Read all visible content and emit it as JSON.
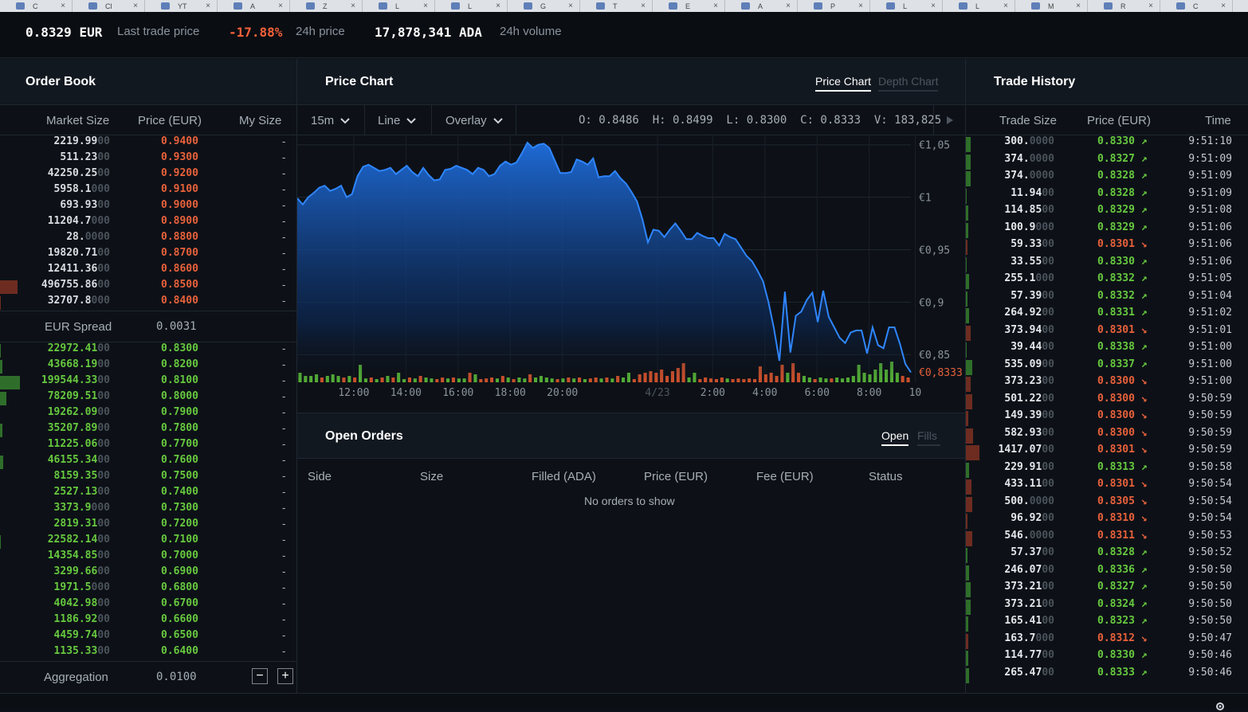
{
  "browser_tabs": [
    "C",
    "Cl",
    "YT",
    "A",
    "Z",
    "L",
    "L",
    "G",
    "T",
    "E",
    "A",
    "P",
    "L",
    "L",
    "M",
    "R",
    "C"
  ],
  "ticker": {
    "last_price": "0.8329",
    "last_ccy": "EUR",
    "last_label": "Last trade price",
    "change": "-17.88%",
    "change_label": "24h price",
    "volume": "17,878,341",
    "volume_ccy": "ADA",
    "volume_label": "24h volume"
  },
  "colors": {
    "ask": "#e8613b",
    "bid": "#67c93f",
    "line": "#2f86ff",
    "bg": "#0d1117"
  },
  "order_book": {
    "title": "Order Book",
    "headers": {
      "market_size": "Market Size",
      "price": "Price (EUR)",
      "my_size": "My Size"
    },
    "asks": [
      {
        "size": "2219.99",
        "pad": "00",
        "price": "0.9400",
        "my": "-",
        "depth": 0
      },
      {
        "size": "511.23",
        "pad": "00",
        "price": "0.9300",
        "my": "-",
        "depth": 0
      },
      {
        "size": "42250.25",
        "pad": "00",
        "price": "0.9200",
        "my": "-",
        "depth": 0
      },
      {
        "size": "5958.1",
        "pad": "000",
        "price": "0.9100",
        "my": "-",
        "depth": 0
      },
      {
        "size": "693.93",
        "pad": "00",
        "price": "0.9000",
        "my": "-",
        "depth": 0
      },
      {
        "size": "11204.7",
        "pad": "000",
        "price": "0.8900",
        "my": "-",
        "depth": 0
      },
      {
        "size": "28.",
        "pad": "0000",
        "price": "0.8800",
        "my": "-",
        "depth": 0
      },
      {
        "size": "19820.71",
        "pad": "00",
        "price": "0.8700",
        "my": "-",
        "depth": 0
      },
      {
        "size": "12411.36",
        "pad": "00",
        "price": "0.8600",
        "my": "-",
        "depth": 0
      },
      {
        "size": "496755.86",
        "pad": "00",
        "price": "0.8500",
        "my": "-",
        "depth": 22
      },
      {
        "size": "32707.8",
        "pad": "000",
        "price": "0.8400",
        "my": "-",
        "depth": 1
      }
    ],
    "spread_label": "EUR Spread",
    "spread_value": "0.0031",
    "bids": [
      {
        "size": "22972.41",
        "pad": "00",
        "price": "0.8300",
        "my": "-",
        "depth": 1
      },
      {
        "size": "43668.19",
        "pad": "00",
        "price": "0.8200",
        "my": "-",
        "depth": 3
      },
      {
        "size": "199544.33",
        "pad": "00",
        "price": "0.8100",
        "my": "-",
        "depth": 25
      },
      {
        "size": "78209.51",
        "pad": "00",
        "price": "0.8000",
        "my": "-",
        "depth": 8
      },
      {
        "size": "19262.09",
        "pad": "00",
        "price": "0.7900",
        "my": "-",
        "depth": 0
      },
      {
        "size": "35207.89",
        "pad": "00",
        "price": "0.7800",
        "my": "-",
        "depth": 3
      },
      {
        "size": "11225.06",
        "pad": "00",
        "price": "0.7700",
        "my": "-",
        "depth": 0
      },
      {
        "size": "46155.34",
        "pad": "00",
        "price": "0.7600",
        "my": "-",
        "depth": 4
      },
      {
        "size": "8159.35",
        "pad": "00",
        "price": "0.7500",
        "my": "-",
        "depth": 0
      },
      {
        "size": "2527.13",
        "pad": "00",
        "price": "0.7400",
        "my": "-",
        "depth": 0
      },
      {
        "size": "3373.9",
        "pad": "000",
        "price": "0.7300",
        "my": "-",
        "depth": 0
      },
      {
        "size": "2819.31",
        "pad": "00",
        "price": "0.7200",
        "my": "-",
        "depth": 0
      },
      {
        "size": "22582.14",
        "pad": "00",
        "price": "0.7100",
        "my": "-",
        "depth": 1
      },
      {
        "size": "14354.85",
        "pad": "00",
        "price": "0.7000",
        "my": "-",
        "depth": 0
      },
      {
        "size": "3299.66",
        "pad": "00",
        "price": "0.6900",
        "my": "-",
        "depth": 0
      },
      {
        "size": "1971.5",
        "pad": "000",
        "price": "0.6800",
        "my": "-",
        "depth": 0
      },
      {
        "size": "4042.98",
        "pad": "00",
        "price": "0.6700",
        "my": "-",
        "depth": 0
      },
      {
        "size": "1186.92",
        "pad": "00",
        "price": "0.6600",
        "my": "-",
        "depth": 0
      },
      {
        "size": "4459.74",
        "pad": "00",
        "price": "0.6500",
        "my": "-",
        "depth": 0
      },
      {
        "size": "1135.33",
        "pad": "00",
        "price": "0.6400",
        "my": "-",
        "depth": 0
      }
    ],
    "aggregation_label": "Aggregation",
    "aggregation_value": "0.0100",
    "minus": "−",
    "plus": "+"
  },
  "price_chart": {
    "title": "Price Chart",
    "tab_active": "Price Chart",
    "tab_inactive": "Depth Chart",
    "interval": "15m",
    "chart_kind": "Line",
    "overlay": "Overlay",
    "ohlc": "O: 0.8486  H: 0.8499  L: 0.8300  C: 0.8333  V: 183,825",
    "current_price_label": "€0,8333"
  },
  "chart_data": {
    "type": "area",
    "title": "",
    "x_tick_labels": [
      "12:00",
      "14:00",
      "16:00",
      "18:00",
      "20:00",
      "4/23",
      "2:00",
      "4:00",
      "6:00",
      "8:00",
      "10"
    ],
    "y_tick_labels": [
      "€1,05",
      "€1",
      "€0,95",
      "€0,9",
      "€0,85"
    ],
    "ylim": [
      0.8236,
      1.0589
    ],
    "current_price": 0.8333,
    "series": [
      {
        "values": [
          0.999,
          0.993,
          1.0,
          1.004,
          1.009,
          1.011,
          1.006,
          1.008,
          1.011,
          1.0,
          1.003,
          1.02,
          1.029,
          1.031,
          1.028,
          1.025,
          1.026,
          1.028,
          1.022,
          1.026,
          1.03,
          1.024,
          1.02,
          1.028,
          1.021,
          1.016,
          1.017,
          1.026,
          1.027,
          1.03,
          1.028,
          1.026,
          1.022,
          1.028,
          1.026,
          1.02,
          1.022,
          1.03,
          1.034,
          1.031,
          1.033,
          1.042,
          1.052,
          1.047,
          1.05,
          1.051,
          1.047,
          1.035,
          1.023,
          1.023,
          1.024,
          1.036,
          1.034,
          1.031,
          1.037,
          1.019,
          1.02,
          1.02,
          1.025,
          1.018,
          1.013,
          1.005,
          0.996,
          0.979,
          0.957,
          0.969,
          0.968,
          0.962,
          0.969,
          0.975,
          0.968,
          0.96,
          0.96,
          0.966,
          0.963,
          0.961,
          0.961,
          0.954,
          0.965,
          0.962,
          0.96,
          0.952,
          0.944,
          0.939,
          0.93,
          0.92,
          0.9,
          0.875,
          0.844,
          0.91,
          0.852,
          0.887,
          0.891,
          0.902,
          0.909,
          0.881,
          0.911,
          0.886,
          0.876,
          0.866,
          0.861,
          0.871,
          0.873,
          0.873,
          0.851,
          0.876,
          0.859,
          0.856,
          0.876,
          0.876,
          0.86,
          0.841,
          0.833
        ]
      }
    ],
    "volume_ticks": [
      {
        "v": 0.3,
        "up": true
      },
      {
        "v": 0.2,
        "up": true
      },
      {
        "v": 0.2,
        "up": true
      },
      {
        "v": 0.25,
        "up": true
      },
      {
        "v": 0.15,
        "up": false
      },
      {
        "v": 0.2,
        "up": true
      },
      {
        "v": 0.25,
        "up": true
      },
      {
        "v": 0.2,
        "up": true
      },
      {
        "v": 0.15,
        "up": false
      },
      {
        "v": 0.2,
        "up": true
      },
      {
        "v": 0.15,
        "up": false
      },
      {
        "v": 0.55,
        "up": true
      },
      {
        "v": 0.12,
        "up": true
      },
      {
        "v": 0.15,
        "up": false
      },
      {
        "v": 0.1,
        "up": true
      },
      {
        "v": 0.15,
        "up": false
      },
      {
        "v": 0.2,
        "up": true
      },
      {
        "v": 0.15,
        "up": false
      },
      {
        "v": 0.3,
        "up": true
      },
      {
        "v": 0.1,
        "up": true
      },
      {
        "v": 0.15,
        "up": false
      },
      {
        "v": 0.12,
        "up": true
      },
      {
        "v": 0.2,
        "up": false
      },
      {
        "v": 0.15,
        "up": true
      },
      {
        "v": 0.12,
        "up": true
      },
      {
        "v": 0.1,
        "up": false
      },
      {
        "v": 0.15,
        "up": false
      },
      {
        "v": 0.12,
        "up": true
      },
      {
        "v": 0.15,
        "up": false
      },
      {
        "v": 0.12,
        "up": true
      },
      {
        "v": 0.12,
        "up": true
      },
      {
        "v": 0.3,
        "up": false
      },
      {
        "v": 0.25,
        "up": true
      },
      {
        "v": 0.1,
        "up": false
      },
      {
        "v": 0.12,
        "up": false
      },
      {
        "v": 0.15,
        "up": false
      },
      {
        "v": 0.12,
        "up": true
      },
      {
        "v": 0.2,
        "up": false
      },
      {
        "v": 0.15,
        "up": true
      },
      {
        "v": 0.1,
        "up": false
      },
      {
        "v": 0.15,
        "up": true
      },
      {
        "v": 0.12,
        "up": true
      },
      {
        "v": 0.25,
        "up": false
      },
      {
        "v": 0.15,
        "up": true
      },
      {
        "v": 0.2,
        "up": true
      },
      {
        "v": 0.15,
        "up": true
      },
      {
        "v": 0.12,
        "up": true
      },
      {
        "v": 0.1,
        "up": false
      },
      {
        "v": 0.12,
        "up": true
      },
      {
        "v": 0.15,
        "up": false
      },
      {
        "v": 0.12,
        "up": true
      },
      {
        "v": 0.15,
        "up": false
      },
      {
        "v": 0.1,
        "up": true
      },
      {
        "v": 0.12,
        "up": false
      },
      {
        "v": 0.15,
        "up": false
      },
      {
        "v": 0.12,
        "up": true
      },
      {
        "v": 0.15,
        "up": false
      },
      {
        "v": 0.12,
        "up": true
      },
      {
        "v": 0.2,
        "up": false
      },
      {
        "v": 0.15,
        "up": true
      },
      {
        "v": 0.3,
        "up": true
      },
      {
        "v": 0.1,
        "up": false
      },
      {
        "v": 0.25,
        "up": false
      },
      {
        "v": 0.3,
        "up": false
      },
      {
        "v": 0.35,
        "up": false
      },
      {
        "v": 0.3,
        "up": false
      },
      {
        "v": 0.4,
        "up": false
      },
      {
        "v": 0.2,
        "up": false
      },
      {
        "v": 0.35,
        "up": false
      },
      {
        "v": 0.45,
        "up": false
      },
      {
        "v": 0.6,
        "up": false
      },
      {
        "v": 0.15,
        "up": true
      },
      {
        "v": 0.3,
        "up": true
      },
      {
        "v": 0.1,
        "up": false
      },
      {
        "v": 0.15,
        "up": false
      },
      {
        "v": 0.12,
        "up": false
      },
      {
        "v": 0.1,
        "up": false
      },
      {
        "v": 0.15,
        "up": false
      },
      {
        "v": 0.12,
        "up": true
      },
      {
        "v": 0.1,
        "up": false
      },
      {
        "v": 0.12,
        "up": false
      },
      {
        "v": 0.1,
        "up": false
      },
      {
        "v": 0.12,
        "up": false
      },
      {
        "v": 0.1,
        "up": false
      },
      {
        "v": 0.5,
        "up": false
      },
      {
        "v": 0.25,
        "up": false
      },
      {
        "v": 0.3,
        "up": false
      },
      {
        "v": 0.2,
        "up": false
      },
      {
        "v": 0.55,
        "up": false
      },
      {
        "v": 0.3,
        "up": true
      },
      {
        "v": 0.6,
        "up": false
      },
      {
        "v": 0.3,
        "up": false
      },
      {
        "v": 0.2,
        "up": true
      },
      {
        "v": 0.15,
        "up": true
      },
      {
        "v": 0.1,
        "up": false
      },
      {
        "v": 0.15,
        "up": true
      },
      {
        "v": 0.12,
        "up": true
      },
      {
        "v": 0.12,
        "up": false
      },
      {
        "v": 0.15,
        "up": true
      },
      {
        "v": 0.12,
        "up": true
      },
      {
        "v": 0.15,
        "up": true
      },
      {
        "v": 0.2,
        "up": true
      },
      {
        "v": 0.55,
        "up": true
      },
      {
        "v": 0.3,
        "up": true
      },
      {
        "v": 0.25,
        "up": true
      },
      {
        "v": 0.4,
        "up": true
      },
      {
        "v": 0.6,
        "up": true
      },
      {
        "v": 0.4,
        "up": true
      },
      {
        "v": 0.65,
        "up": true
      },
      {
        "v": 0.3,
        "up": true
      },
      {
        "v": 0.2,
        "up": false
      },
      {
        "v": 0.15,
        "up": false
      }
    ]
  },
  "open_orders": {
    "title": "Open Orders",
    "tab_active": "Open",
    "tab_inactive": "Fills",
    "headers": [
      "Side",
      "Size",
      "Filled (ADA)",
      "Price (EUR)",
      "Fee (EUR)",
      "Status"
    ],
    "empty_text": "No orders to show"
  },
  "trade_history": {
    "title": "Trade History",
    "headers": {
      "size": "Trade Size",
      "price": "Price (EUR)",
      "time": "Time"
    },
    "rows": [
      {
        "size": "300.",
        "pad": "0000",
        "price": "0.8330",
        "dir": "up",
        "time": "9:51:10",
        "depth": 6
      },
      {
        "size": "374.",
        "pad": "0000",
        "price": "0.8327",
        "dir": "up",
        "time": "9:51:09",
        "depth": 6
      },
      {
        "size": "374.",
        "pad": "0000",
        "price": "0.8328",
        "dir": "up",
        "time": "9:51:09",
        "depth": 6
      },
      {
        "size": "11.94",
        "pad": "00",
        "price": "0.8328",
        "dir": "up",
        "time": "9:51:09",
        "depth": 1
      },
      {
        "size": "114.85",
        "pad": "00",
        "price": "0.8329",
        "dir": "up",
        "time": "9:51:08",
        "depth": 3
      },
      {
        "size": "100.9",
        "pad": "000",
        "price": "0.8329",
        "dir": "up",
        "time": "9:51:06",
        "depth": 3
      },
      {
        "size": "59.33",
        "pad": "00",
        "price": "0.8301",
        "dir": "down",
        "time": "9:51:06",
        "depth": 2
      },
      {
        "size": "33.55",
        "pad": "00",
        "price": "0.8330",
        "dir": "up",
        "time": "9:51:06",
        "depth": 1
      },
      {
        "size": "255.1",
        "pad": "000",
        "price": "0.8332",
        "dir": "up",
        "time": "9:51:05",
        "depth": 4
      },
      {
        "size": "57.39",
        "pad": "00",
        "price": "0.8332",
        "dir": "up",
        "time": "9:51:04",
        "depth": 2
      },
      {
        "size": "264.92",
        "pad": "00",
        "price": "0.8331",
        "dir": "up",
        "time": "9:51:02",
        "depth": 4
      },
      {
        "size": "373.94",
        "pad": "00",
        "price": "0.8301",
        "dir": "down",
        "time": "9:51:01",
        "depth": 6
      },
      {
        "size": "39.44",
        "pad": "00",
        "price": "0.8338",
        "dir": "up",
        "time": "9:51:00",
        "depth": 1
      },
      {
        "size": "535.09",
        "pad": "00",
        "price": "0.8337",
        "dir": "up",
        "time": "9:51:00",
        "depth": 8
      },
      {
        "size": "373.23",
        "pad": "00",
        "price": "0.8300",
        "dir": "down",
        "time": "9:51:00",
        "depth": 6
      },
      {
        "size": "501.22",
        "pad": "00",
        "price": "0.8300",
        "dir": "down",
        "time": "9:50:59",
        "depth": 8
      },
      {
        "size": "149.39",
        "pad": "00",
        "price": "0.8300",
        "dir": "down",
        "time": "9:50:59",
        "depth": 3
      },
      {
        "size": "582.93",
        "pad": "00",
        "price": "0.8300",
        "dir": "down",
        "time": "9:50:59",
        "depth": 9
      },
      {
        "size": "1417.07",
        "pad": "00",
        "price": "0.8301",
        "dir": "down",
        "time": "9:50:59",
        "depth": 17
      },
      {
        "size": "229.91",
        "pad": "00",
        "price": "0.8313",
        "dir": "up",
        "time": "9:50:58",
        "depth": 4
      },
      {
        "size": "433.11",
        "pad": "00",
        "price": "0.8301",
        "dir": "down",
        "time": "9:50:54",
        "depth": 7
      },
      {
        "size": "500.",
        "pad": "0000",
        "price": "0.8305",
        "dir": "down",
        "time": "9:50:54",
        "depth": 8
      },
      {
        "size": "96.92",
        "pad": "00",
        "price": "0.8310",
        "dir": "down",
        "time": "9:50:54",
        "depth": 2
      },
      {
        "size": "546.",
        "pad": "0000",
        "price": "0.8311",
        "dir": "down",
        "time": "9:50:53",
        "depth": 8
      },
      {
        "size": "57.37",
        "pad": "00",
        "price": "0.8328",
        "dir": "up",
        "time": "9:50:52",
        "depth": 2
      },
      {
        "size": "246.07",
        "pad": "00",
        "price": "0.8336",
        "dir": "up",
        "time": "9:50:50",
        "depth": 4
      },
      {
        "size": "373.21",
        "pad": "00",
        "price": "0.8327",
        "dir": "up",
        "time": "9:50:50",
        "depth": 6
      },
      {
        "size": "373.21",
        "pad": "00",
        "price": "0.8324",
        "dir": "up",
        "time": "9:50:50",
        "depth": 6
      },
      {
        "size": "165.41",
        "pad": "00",
        "price": "0.8323",
        "dir": "up",
        "time": "9:50:50",
        "depth": 3
      },
      {
        "size": "163.7",
        "pad": "000",
        "price": "0.8312",
        "dir": "down",
        "time": "9:50:47",
        "depth": 3
      },
      {
        "size": "114.77",
        "pad": "00",
        "price": "0.8330",
        "dir": "up",
        "time": "9:50:46",
        "depth": 3
      },
      {
        "size": "265.47",
        "pad": "00",
        "price": "0.8333",
        "dir": "up",
        "time": "9:50:46",
        "depth": 4
      }
    ]
  }
}
